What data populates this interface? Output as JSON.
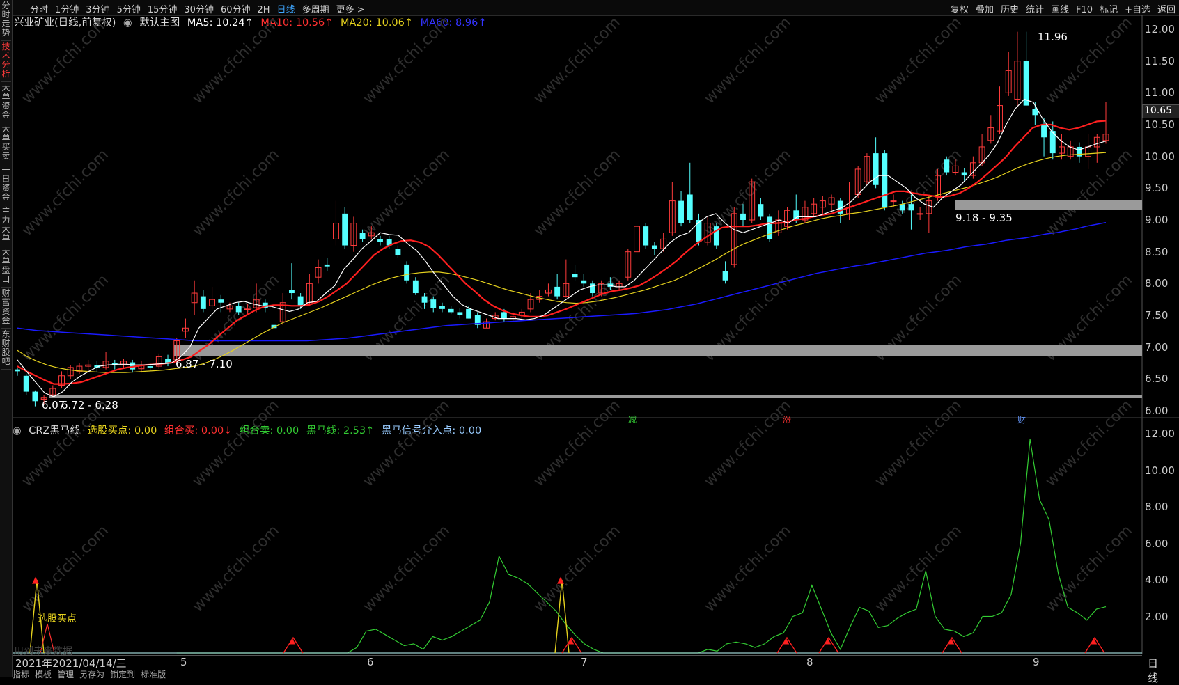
{
  "sidebar": {
    "items": [
      {
        "label": "分时走势",
        "active": false
      },
      {
        "label": "技术分析",
        "active": true
      },
      {
        "label": "大单资金",
        "active": false
      },
      {
        "label": "大单买卖",
        "active": false
      },
      {
        "label": "一日资金",
        "active": false
      },
      {
        "label": "主力大单",
        "active": false
      },
      {
        "label": "大单盘口",
        "active": false
      },
      {
        "label": "财富资金",
        "active": false
      },
      {
        "label": "东财股吧",
        "active": false
      }
    ]
  },
  "toolbar": {
    "periods": [
      "分时",
      "1分钟",
      "3分钟",
      "5分钟",
      "15分钟",
      "30分钟",
      "60分钟",
      "2H",
      "日线",
      "多周期",
      "更多 >"
    ],
    "active_period": "日线",
    "actions": [
      "复权",
      "叠加",
      "历史",
      "统计",
      "画线",
      "F10",
      "标记",
      "+自选",
      "返回"
    ]
  },
  "main_legend": {
    "title": "兴业矿业(日线,前复权)",
    "main_chart": "默认主图",
    "ma5": "MA5: 10.24↑",
    "ma10": "MA10: 10.56↑",
    "ma20": "MA20: 10.06↑",
    "ma60": "MA60: 8.96↑"
  },
  "sub_legend": {
    "name": "CRZ黑马线",
    "xg": "选股买点: 0.00",
    "zhb": "组合买: 0.00↓",
    "zhs": "组合卖: 0.00",
    "hmx": "黑马线: 2.53↑",
    "hmxh": "黑马信号介入点: 0.00"
  },
  "price_axis": [
    "12.00",
    "11.50",
    "11.00",
    "10.50",
    "10.00",
    "9.50",
    "9.00",
    "8.50",
    "8.00",
    "7.50",
    "7.00",
    "6.50",
    "6.00"
  ],
  "current_price": "10.65",
  "sub_axis": [
    "12.00",
    "10.00",
    "8.00",
    "6.00",
    "4.00",
    "2.00"
  ],
  "annotations": {
    "high": "11.96",
    "low": "6.07",
    "zone1": "6.72 - 6.28",
    "zone2": "6.87 - 7.10",
    "zone3": "9.18 - 9.35",
    "buy_point": "选股买点",
    "watermark_hint": "用到未来数据",
    "markers": [
      "减",
      "涨",
      "财"
    ]
  },
  "watermark": "www.cfchi.com",
  "x_axis": {
    "date": "2021年2021/04/14/三",
    "months": [
      "5",
      "6",
      "7",
      "8",
      "9"
    ]
  },
  "period_label": "日线",
  "bottom_tabs": [
    "指标",
    "模板",
    "管理",
    "另存为",
    "锁定到",
    "标准版"
  ],
  "colors": {
    "up": "#ff3b3b",
    "down": "#54ffff",
    "ma5": "#ffffff",
    "ma10": "#ff2020",
    "ma20": "#e6d21e",
    "ma60": "#1a1aff",
    "signal": "#33cc33"
  },
  "chart_data": {
    "type": "candlestick",
    "candles": [
      [
        6.65,
        6.62,
        6.68,
        6.55
      ],
      [
        6.55,
        6.3,
        6.58,
        6.25
      ],
      [
        6.3,
        6.15,
        6.32,
        6.07
      ],
      [
        6.18,
        6.2,
        6.25,
        6.1
      ],
      [
        6.25,
        6.35,
        6.4,
        6.22
      ],
      [
        6.4,
        6.55,
        6.62,
        6.35
      ],
      [
        6.55,
        6.68,
        6.72,
        6.5
      ],
      [
        6.62,
        6.7,
        6.75,
        6.58
      ],
      [
        6.7,
        6.72,
        6.8,
        6.62
      ],
      [
        6.72,
        6.68,
        6.78,
        6.6
      ],
      [
        6.68,
        6.78,
        6.92,
        6.65
      ],
      [
        6.75,
        6.72,
        6.8,
        6.65
      ],
      [
        6.72,
        6.78,
        6.82,
        6.68
      ],
      [
        6.76,
        6.65,
        6.8,
        6.6
      ],
      [
        6.66,
        6.72,
        6.78,
        6.6
      ],
      [
        6.7,
        6.68,
        6.75,
        6.62
      ],
      [
        6.7,
        6.85,
        6.9,
        6.66
      ],
      [
        6.82,
        6.75,
        6.88,
        6.7
      ],
      [
        6.8,
        7.1,
        7.15,
        6.75
      ],
      [
        7.25,
        7.3,
        7.45,
        7.15
      ],
      [
        7.7,
        7.85,
        8.05,
        7.5
      ],
      [
        7.8,
        7.6,
        7.9,
        7.55
      ],
      [
        7.65,
        7.75,
        7.95,
        7.6
      ],
      [
        7.75,
        7.7,
        7.82,
        7.55
      ],
      [
        7.6,
        7.65,
        7.7,
        7.55
      ],
      [
        7.65,
        7.55,
        7.7,
        7.5
      ],
      [
        7.6,
        7.6,
        7.68,
        7.5
      ],
      [
        7.62,
        7.75,
        8.0,
        7.55
      ],
      [
        7.7,
        7.62,
        7.75,
        7.55
      ],
      [
        7.35,
        7.3,
        7.45,
        7.2
      ],
      [
        7.4,
        7.7,
        7.85,
        7.35
      ],
      [
        7.9,
        7.85,
        8.32,
        7.75
      ],
      [
        7.8,
        7.65,
        7.85,
        7.6
      ],
      [
        7.7,
        8.0,
        8.15,
        7.65
      ],
      [
        8.1,
        8.25,
        8.38,
        8.0
      ],
      [
        8.3,
        8.27,
        8.4,
        8.2
      ],
      [
        8.7,
        8.95,
        9.3,
        8.6
      ],
      [
        9.1,
        8.6,
        9.2,
        8.55
      ],
      [
        8.6,
        8.95,
        9.05,
        8.5
      ],
      [
        8.8,
        8.7,
        8.85,
        8.65
      ],
      [
        8.75,
        8.8,
        8.9,
        8.7
      ],
      [
        8.7,
        8.65,
        8.75,
        8.6
      ],
      [
        8.7,
        8.6,
        8.75,
        8.55
      ],
      [
        8.55,
        8.45,
        8.6,
        8.4
      ],
      [
        8.3,
        8.05,
        8.35,
        8.0
      ],
      [
        8.05,
        7.85,
        8.1,
        7.82
      ],
      [
        7.8,
        7.7,
        7.85,
        7.6
      ],
      [
        7.75,
        7.62,
        7.8,
        7.55
      ],
      [
        7.65,
        7.6,
        7.7,
        7.55
      ],
      [
        7.6,
        7.55,
        7.65,
        7.52
      ],
      [
        7.55,
        7.5,
        7.62,
        7.45
      ],
      [
        7.6,
        7.45,
        7.65,
        7.45
      ],
      [
        7.5,
        7.35,
        7.55,
        7.3
      ],
      [
        7.3,
        7.4,
        7.45,
        7.3
      ],
      [
        7.45,
        7.5,
        7.55,
        7.42
      ],
      [
        7.55,
        7.45,
        7.6,
        7.4
      ],
      [
        7.45,
        7.48,
        7.55,
        7.4
      ],
      [
        7.5,
        7.55,
        7.6,
        7.45
      ],
      [
        7.6,
        7.75,
        7.85,
        7.55
      ],
      [
        7.75,
        7.8,
        7.9,
        7.7
      ],
      [
        7.85,
        7.9,
        8.0,
        7.8
      ],
      [
        7.95,
        7.8,
        8.15,
        7.75
      ],
      [
        7.8,
        8.0,
        8.38,
        7.78
      ],
      [
        8.15,
        8.1,
        8.3,
        8.05
      ],
      [
        8.05,
        8.0,
        8.15,
        7.95
      ],
      [
        8.0,
        7.85,
        8.05,
        7.8
      ],
      [
        7.85,
        8.0,
        8.05,
        7.8
      ],
      [
        8.0,
        7.95,
        8.1,
        7.9
      ],
      [
        7.95,
        8.0,
        8.05,
        7.9
      ],
      [
        8.1,
        8.5,
        8.55,
        8.05
      ],
      [
        8.5,
        8.9,
        9.0,
        8.45
      ],
      [
        8.9,
        8.6,
        8.95,
        8.55
      ],
      [
        8.6,
        8.55,
        8.65,
        8.45
      ],
      [
        8.55,
        8.7,
        8.8,
        8.5
      ],
      [
        8.8,
        9.3,
        9.6,
        8.75
      ],
      [
        9.3,
        8.95,
        9.45,
        8.9
      ],
      [
        9.4,
        9.0,
        9.9,
        8.95
      ],
      [
        9.0,
        8.65,
        9.1,
        8.6
      ],
      [
        8.65,
        8.95,
        9.05,
        8.6
      ],
      [
        8.9,
        8.6,
        8.95,
        8.55
      ],
      [
        8.2,
        8.05,
        8.35,
        8.0
      ],
      [
        8.3,
        9.1,
        9.2,
        8.25
      ],
      [
        9.1,
        9.0,
        9.25,
        8.9
      ],
      [
        9.0,
        9.6,
        9.65,
        8.95
      ],
      [
        9.25,
        9.05,
        9.35,
        9.0
      ],
      [
        9.05,
        8.7,
        9.1,
        8.65
      ],
      [
        8.8,
        9.0,
        9.15,
        8.75
      ],
      [
        8.9,
        9.15,
        9.2,
        8.85
      ],
      [
        9.15,
        9.0,
        9.4,
        8.95
      ],
      [
        9.0,
        9.2,
        9.3,
        8.95
      ],
      [
        9.1,
        9.25,
        9.35,
        9.05
      ],
      [
        9.2,
        9.3,
        9.38,
        9.1
      ],
      [
        9.25,
        9.35,
        9.4,
        9.15
      ],
      [
        9.3,
        9.1,
        9.35,
        8.95
      ],
      [
        9.1,
        9.2,
        9.6,
        9.0
      ],
      [
        9.4,
        9.8,
        9.85,
        9.35
      ],
      [
        9.6,
        10.0,
        10.05,
        9.55
      ],
      [
        10.05,
        9.55,
        10.3,
        9.5
      ],
      [
        10.05,
        9.2,
        10.1,
        9.15
      ],
      [
        9.3,
        9.3,
        9.4,
        9.2
      ],
      [
        9.25,
        9.15,
        9.3,
        9.1
      ],
      [
        9.25,
        9.15,
        9.4,
        8.85
      ],
      [
        9.1,
        9.1,
        9.2,
        9.0
      ],
      [
        9.1,
        9.3,
        9.4,
        8.8
      ],
      [
        9.35,
        9.7,
        9.8,
        9.3
      ],
      [
        9.95,
        9.75,
        10.0,
        9.7
      ],
      [
        9.75,
        9.85,
        9.95,
        9.7
      ],
      [
        9.75,
        9.7,
        9.82,
        9.6
      ],
      [
        9.7,
        9.9,
        10.0,
        9.65
      ],
      [
        9.9,
        10.15,
        10.35,
        9.85
      ],
      [
        10.25,
        10.45,
        10.65,
        10.2
      ],
      [
        10.4,
        10.8,
        11.1,
        10.35
      ],
      [
        11.0,
        11.35,
        11.65,
        10.95
      ],
      [
        10.9,
        11.5,
        11.96,
        10.8
      ],
      [
        11.5,
        10.8,
        11.96,
        10.8
      ],
      [
        10.75,
        10.65,
        10.85,
        10.5
      ],
      [
        10.5,
        10.3,
        10.6,
        10.0
      ],
      [
        10.4,
        10.05,
        10.55,
        9.95
      ],
      [
        10.05,
        10.15,
        10.35,
        9.95
      ],
      [
        10.0,
        10.15,
        10.25,
        9.95
      ],
      [
        10.15,
        10.0,
        10.22,
        9.9
      ],
      [
        10.0,
        10.15,
        10.35,
        9.8
      ],
      [
        10.15,
        10.3,
        10.35,
        9.9
      ],
      [
        10.25,
        10.35,
        10.85,
        10.2
      ]
    ],
    "ma5": [
      6.8,
      6.62,
      6.45,
      6.28,
      6.22,
      6.3,
      6.45,
      6.55,
      6.63,
      6.7,
      6.72,
      6.73,
      6.73,
      6.72,
      6.72,
      6.73,
      6.74,
      6.75,
      6.85,
      7.0,
      7.3,
      7.45,
      7.6,
      7.65,
      7.7,
      7.72,
      7.68,
      7.65,
      7.64,
      7.6,
      7.56,
      7.6,
      7.7,
      7.72,
      7.85,
      7.97,
      8.23,
      8.38,
      8.55,
      8.67,
      8.8,
      8.77,
      8.76,
      8.63,
      8.52,
      8.35,
      8.15,
      7.98,
      7.8,
      7.67,
      7.6,
      7.55,
      7.5,
      7.45,
      7.45,
      7.45,
      7.43,
      7.45,
      7.5,
      7.6,
      7.7,
      7.8,
      7.9,
      7.95,
      7.98,
      7.98,
      7.95,
      7.95,
      8.05,
      8.2,
      8.35,
      8.5,
      8.65,
      8.75,
      8.8,
      8.95,
      9.05,
      9.1,
      8.95,
      8.85,
      8.8,
      8.85,
      8.9,
      8.95,
      9.0,
      8.95,
      9.05,
      9.05,
      9.05,
      9.1,
      9.15,
      9.2,
      9.3,
      9.45,
      9.6,
      9.7,
      9.7,
      9.6,
      9.5,
      9.35,
      9.25,
      9.2,
      9.35,
      9.45,
      9.55,
      9.7,
      9.85,
      10.0,
      10.2,
      10.5,
      10.75,
      10.9,
      10.85,
      10.6,
      10.4,
      10.25,
      10.15,
      10.1,
      10.15,
      10.2,
      10.24
    ],
    "ma10": [
      6.7,
      6.62,
      6.55,
      6.48,
      6.42,
      6.42,
      6.43,
      6.45,
      6.5,
      6.55,
      6.6,
      6.65,
      6.68,
      6.7,
      6.72,
      6.73,
      6.74,
      6.76,
      6.8,
      6.85,
      6.95,
      7.05,
      7.18,
      7.3,
      7.42,
      7.5,
      7.58,
      7.64,
      7.66,
      7.66,
      7.65,
      7.65,
      7.67,
      7.72,
      7.8,
      7.9,
      8.0,
      8.15,
      8.3,
      8.45,
      8.55,
      8.62,
      8.67,
      8.68,
      8.65,
      8.58,
      8.45,
      8.3,
      8.15,
      8.0,
      7.88,
      7.75,
      7.65,
      7.58,
      7.53,
      7.5,
      7.48,
      7.48,
      7.5,
      7.55,
      7.6,
      7.66,
      7.72,
      7.78,
      7.84,
      7.88,
      7.9,
      7.93,
      7.97,
      8.05,
      8.14,
      8.24,
      8.35,
      8.48,
      8.6,
      8.7,
      8.8,
      8.88,
      8.9,
      8.9,
      8.9,
      8.92,
      8.95,
      8.95,
      8.96,
      9.0,
      9.02,
      9.05,
      9.08,
      9.1,
      9.15,
      9.2,
      9.25,
      9.3,
      9.35,
      9.4,
      9.45,
      9.45,
      9.42,
      9.4,
      9.38,
      9.36,
      9.38,
      9.42,
      9.5,
      9.6,
      9.72,
      9.85,
      9.98,
      10.15,
      10.3,
      10.45,
      10.5,
      10.5,
      10.45,
      10.42,
      10.45,
      10.5,
      10.55,
      10.56
    ],
    "ma20": [
      6.95,
      6.85,
      6.78,
      6.72,
      6.68,
      6.65,
      6.63,
      6.62,
      6.61,
      6.6,
      6.6,
      6.6,
      6.61,
      6.62,
      6.63,
      6.64,
      6.66,
      6.68,
      6.7,
      6.74,
      6.8,
      6.87,
      6.95,
      7.04,
      7.13,
      7.22,
      7.3,
      7.38,
      7.44,
      7.5,
      7.56,
      7.62,
      7.69,
      7.76,
      7.83,
      7.9,
      7.97,
      8.03,
      8.08,
      8.12,
      8.15,
      8.17,
      8.18,
      8.18,
      8.16,
      8.13,
      8.09,
      8.05,
      8.0,
      7.95,
      7.9,
      7.86,
      7.82,
      7.78,
      7.75,
      7.72,
      7.7,
      7.69,
      7.7,
      7.72,
      7.75,
      7.78,
      7.82,
      7.86,
      7.9,
      7.95,
      8.0,
      8.05,
      8.12,
      8.2,
      8.28,
      8.36,
      8.45,
      8.54,
      8.62,
      8.68,
      8.74,
      8.8,
      8.85,
      8.9,
      8.94,
      8.98,
      9.02,
      9.05,
      9.07,
      9.1,
      9.12,
      9.15,
      9.18,
      9.21,
      9.24,
      9.28,
      9.32,
      9.36,
      9.4,
      9.44,
      9.48,
      9.52,
      9.57,
      9.62,
      9.68,
      9.75,
      9.82,
      9.88,
      9.93,
      9.97,
      10.0,
      10.02,
      10.03,
      10.04,
      10.05,
      10.06
    ],
    "ma60": [
      7.3,
      7.28,
      7.26,
      7.25,
      7.24,
      7.23,
      7.22,
      7.21,
      7.2,
      7.19,
      7.18,
      7.17,
      7.16,
      7.15,
      7.14,
      7.13,
      7.12,
      7.11,
      7.1,
      7.1,
      7.1,
      7.1,
      7.1,
      7.1,
      7.1,
      7.1,
      7.1,
      7.1,
      7.1,
      7.1,
      7.11,
      7.12,
      7.13,
      7.14,
      7.16,
      7.18,
      7.2,
      7.22,
      7.24,
      7.26,
      7.28,
      7.3,
      7.32,
      7.34,
      7.35,
      7.36,
      7.37,
      7.38,
      7.39,
      7.4,
      7.41,
      7.42,
      7.43,
      7.44,
      7.45,
      7.46,
      7.47,
      7.48,
      7.49,
      7.5,
      7.51,
      7.52,
      7.53,
      7.55,
      7.57,
      7.59,
      7.62,
      7.65,
      7.68,
      7.72,
      7.76,
      7.8,
      7.84,
      7.88,
      7.92,
      7.96,
      8.0,
      8.04,
      8.08,
      8.12,
      8.16,
      8.19,
      8.22,
      8.25,
      8.28,
      8.3,
      8.33,
      8.36,
      8.39,
      8.42,
      8.45,
      8.48,
      8.5,
      8.52,
      8.55,
      8.58,
      8.6,
      8.62,
      8.65,
      8.68,
      8.7,
      8.72,
      8.75,
      8.78,
      8.8,
      8.83,
      8.86,
      8.9,
      8.93,
      8.96
    ],
    "signal": [
      0,
      0,
      0,
      0,
      0,
      0,
      0,
      0,
      0,
      0,
      0,
      0,
      0,
      0,
      0,
      0,
      0,
      0,
      0,
      0.3,
      1.2,
      1.3,
      1.0,
      0.7,
      0.4,
      0.5,
      0.2,
      0.9,
      0.7,
      0.9,
      1.2,
      1.5,
      1.8,
      2.8,
      5.3,
      4.3,
      4.1,
      3.8,
      3.3,
      2.8,
      2.3,
      1.6,
      1.0,
      0.5,
      0.2,
      0,
      0,
      0,
      0,
      0,
      0,
      0,
      0,
      0,
      0,
      0,
      0.2,
      0.1,
      0.5,
      0.6,
      0.5,
      0.3,
      0.5,
      0.9,
      1.1,
      2.0,
      2.2,
      3.7,
      2.4,
      1.1,
      0.2,
      1.4,
      2.5,
      2.3,
      1.4,
      1.5,
      1.9,
      2.2,
      2.4,
      4.5,
      2.0,
      1.3,
      1.2,
      0.9,
      1.1,
      2.0,
      2.0,
      2.2,
      3.2,
      6.0,
      11.7,
      8.4,
      7.3,
      4.3,
      2.5,
      2.2,
      1.8,
      2.4,
      2.53
    ],
    "ylim": [
      6.0,
      12.0
    ],
    "sub_ylim": [
      0,
      12.0
    ]
  }
}
